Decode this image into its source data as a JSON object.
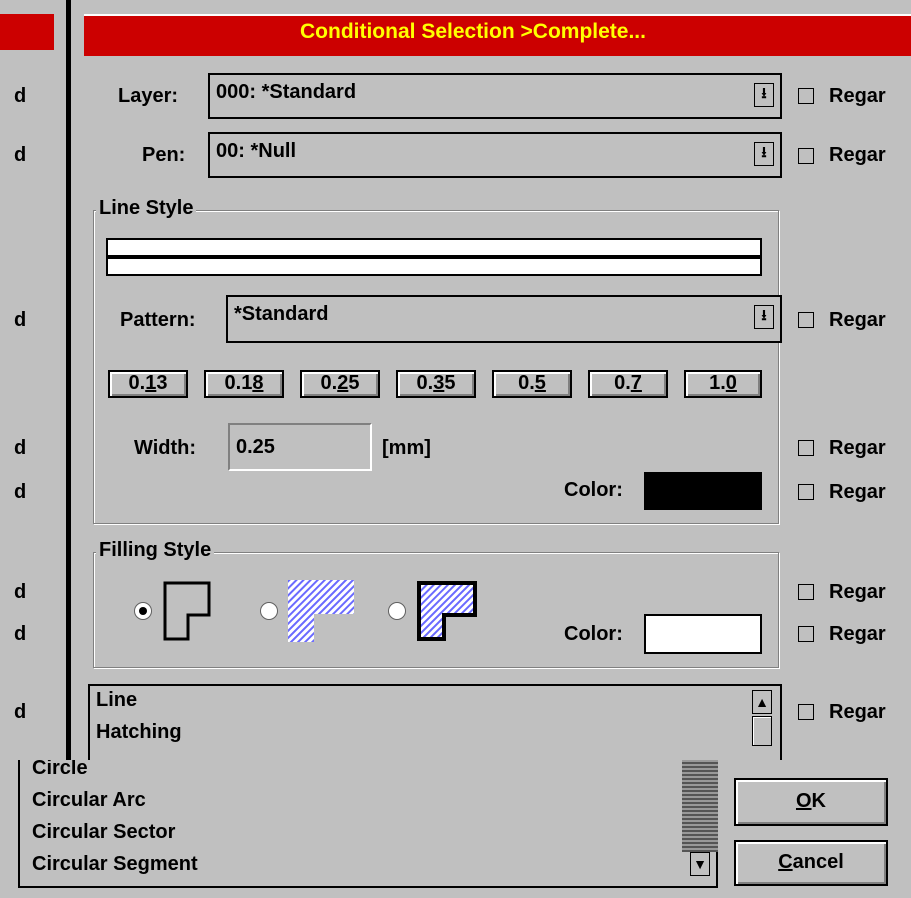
{
  "dialog": {
    "title": "Conditional Selection >Complete...",
    "title_bg": "#cc0000",
    "title_fg": "#ffff00"
  },
  "left_panel": {
    "labels": [
      "d",
      "d",
      "d",
      "d",
      "d",
      "d",
      "d",
      "d"
    ]
  },
  "fields": {
    "layer": {
      "label": "Layer:",
      "value": "000: *Standard"
    },
    "pen": {
      "label": "Pen:",
      "value": "00: *Null"
    }
  },
  "regard_label": "Regar",
  "line_style": {
    "title": "Line Style",
    "pattern_label": "Pattern:",
    "pattern_value": "*Standard",
    "width_buttons": [
      {
        "pre": "0.",
        "ul": "1",
        "post": "3"
      },
      {
        "pre": "0.1",
        "ul": "8",
        "post": ""
      },
      {
        "pre": "0.",
        "ul": "2",
        "post": "5"
      },
      {
        "pre": "0.",
        "ul": "3",
        "post": "5"
      },
      {
        "pre": "0.",
        "ul": "5",
        "post": ""
      },
      {
        "pre": "0.",
        "ul": "7",
        "post": ""
      },
      {
        "pre": "1.",
        "ul": "0",
        "post": ""
      }
    ],
    "width_label": "Width:",
    "width_value": "0.25",
    "width_unit": "[mm]",
    "color_label": "Color:",
    "color_value": "#000000"
  },
  "filling_style": {
    "title": "Filling Style",
    "options": [
      "outline",
      "hatched",
      "hatched-outlined"
    ],
    "selected": 0,
    "color_label": "Color:",
    "color_value": "#ffffff"
  },
  "type_list": {
    "items": [
      "Line",
      "Hatching"
    ]
  },
  "element_list": {
    "items": [
      "Circle",
      "Circular Arc",
      "Circular Sector",
      "Circular Segment"
    ]
  },
  "buttons": {
    "ok": {
      "ul": "O",
      "rest": "K"
    },
    "cancel": {
      "ul": "C",
      "rest": "ancel"
    }
  }
}
